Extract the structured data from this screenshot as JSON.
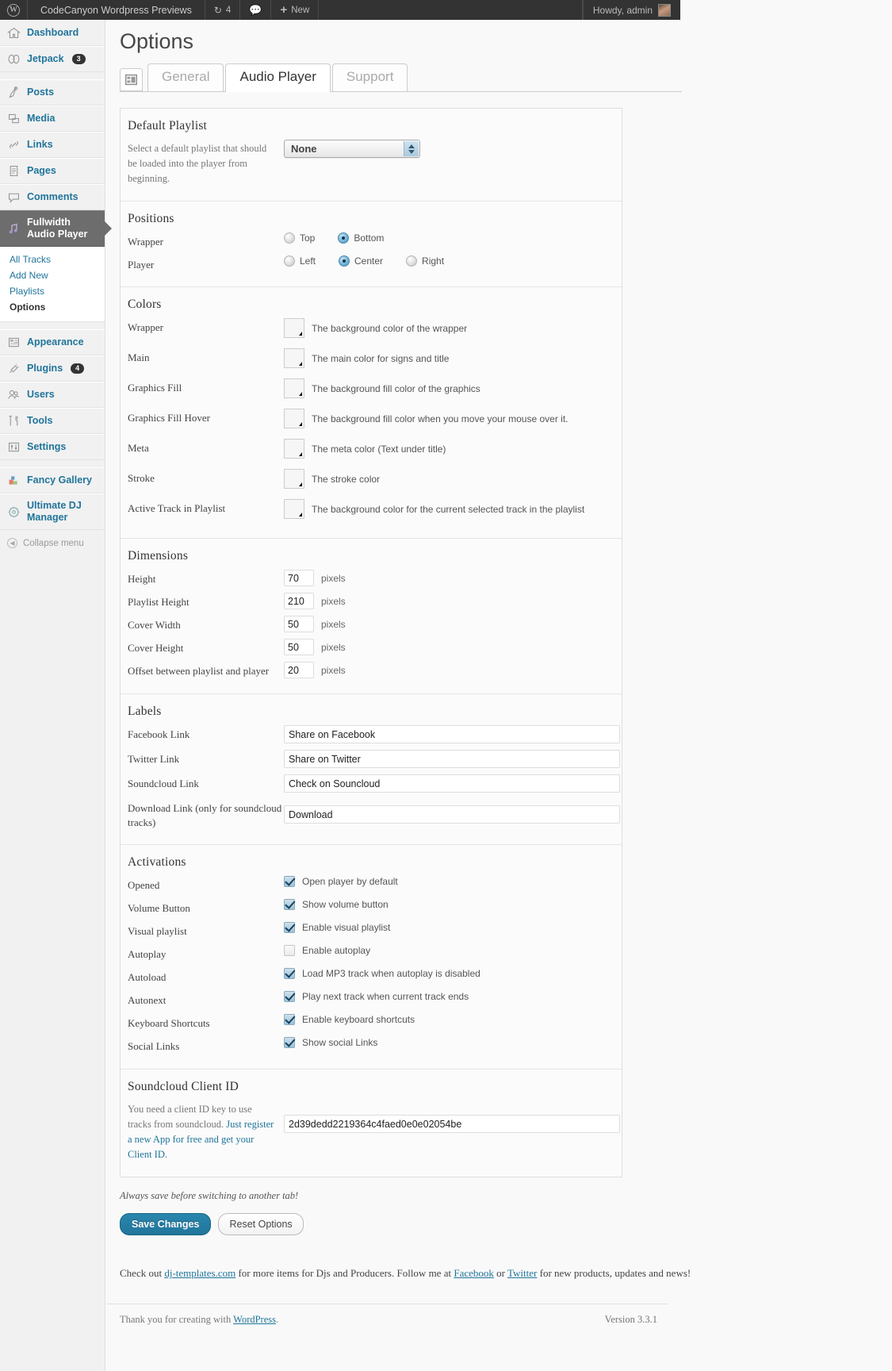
{
  "adminbar": {
    "site_name": "CodeCanyon Wordpress Previews",
    "updates_count": "4",
    "comments_icon": "comment-icon",
    "new_label": "New",
    "howdy": "Howdy, admin"
  },
  "sidebar": {
    "items": [
      {
        "label": "Dashboard",
        "icon": "dashboard-icon",
        "badge": ""
      },
      {
        "label": "Jetpack",
        "icon": "jetpack-icon",
        "badge": "3"
      },
      {
        "label": "Posts",
        "icon": "posts-icon",
        "badge": ""
      },
      {
        "label": "Media",
        "icon": "media-icon",
        "badge": ""
      },
      {
        "label": "Links",
        "icon": "links-icon",
        "badge": ""
      },
      {
        "label": "Pages",
        "icon": "pages-icon",
        "badge": ""
      },
      {
        "label": "Comments",
        "icon": "comments-icon",
        "badge": ""
      },
      {
        "label": "Fullwidth Audio Player",
        "icon": "audio-player-icon",
        "badge": ""
      }
    ],
    "submenu": [
      {
        "label": "All Tracks",
        "active": false
      },
      {
        "label": "Add New",
        "active": false
      },
      {
        "label": "Playlists",
        "active": false
      },
      {
        "label": "Options",
        "active": true
      }
    ],
    "items2": [
      {
        "label": "Appearance",
        "icon": "appearance-icon",
        "badge": ""
      },
      {
        "label": "Plugins",
        "icon": "plugins-icon",
        "badge": "4"
      },
      {
        "label": "Users",
        "icon": "users-icon",
        "badge": ""
      },
      {
        "label": "Tools",
        "icon": "tools-icon",
        "badge": ""
      },
      {
        "label": "Settings",
        "icon": "settings-icon",
        "badge": ""
      }
    ],
    "items3": [
      {
        "label": "Fancy Gallery",
        "icon": "fancy-gallery-icon",
        "badge": ""
      },
      {
        "label": "Ultimate DJ Manager",
        "icon": "ultimate-dj-icon",
        "badge": ""
      }
    ],
    "collapse_label": "Collapse menu"
  },
  "page": {
    "title": "Options"
  },
  "tabs": [
    {
      "label": "General",
      "active": false
    },
    {
      "label": "Audio Player",
      "active": true
    },
    {
      "label": "Support",
      "active": false
    }
  ],
  "default_playlist": {
    "title": "Default Playlist",
    "description": "Select a default playlist that should be loaded into the player from beginning.",
    "selected": "None"
  },
  "positions": {
    "title": "Positions",
    "rows": [
      {
        "label": "Wrapper",
        "options": [
          {
            "label": "Top",
            "selected": false
          },
          {
            "label": "Bottom",
            "selected": true
          }
        ]
      },
      {
        "label": "Player",
        "options": [
          {
            "label": "Left",
            "selected": false
          },
          {
            "label": "Center",
            "selected": true
          },
          {
            "label": "Right",
            "selected": false
          }
        ]
      }
    ]
  },
  "colors": {
    "title": "Colors",
    "rows": [
      {
        "label": "Wrapper",
        "value": "#1a1a1a",
        "desc": "The background color of the wrapper"
      },
      {
        "label": "Main",
        "value": "#ffffff",
        "desc": "The main color for signs and title"
      },
      {
        "label": "Graphics Fill",
        "value": "#0d0d0d",
        "desc": "The background fill color of the graphics"
      },
      {
        "label": "Graphics Fill Hover",
        "value": "#0d0d0d",
        "desc": "The background fill color when you move your mouse over it."
      },
      {
        "label": "Meta",
        "value": "#666666",
        "desc": "The meta color (Text under title)"
      },
      {
        "label": "Stroke",
        "value": "#2b2b2b",
        "desc": "The stroke color"
      },
      {
        "label": "Active Track in Playlist",
        "value": "#0d0d0d",
        "desc": "The background color for the current selected track in the playlist"
      }
    ]
  },
  "dimensions": {
    "title": "Dimensions",
    "unit": "pixels",
    "rows": [
      {
        "label": "Height",
        "value": "70"
      },
      {
        "label": "Playlist Height",
        "value": "210"
      },
      {
        "label": "Cover Width",
        "value": "50"
      },
      {
        "label": "Cover Height",
        "value": "50"
      },
      {
        "label": "Offset between playlist and player",
        "value": "20"
      }
    ]
  },
  "labels": {
    "title": "Labels",
    "rows": [
      {
        "label": "Facebook Link",
        "value": "Share on Facebook"
      },
      {
        "label": "Twitter Link",
        "value": "Share on Twitter"
      },
      {
        "label": "Soundcloud Link",
        "value": "Check on Souncloud"
      },
      {
        "label": "Download Link (only for soundcloud tracks)",
        "value": "Download"
      }
    ]
  },
  "activations": {
    "title": "Activations",
    "rows": [
      {
        "label": "Opened",
        "desc": "Open player by default",
        "checked": true
      },
      {
        "label": "Volume Button",
        "desc": "Show volume button",
        "checked": true
      },
      {
        "label": "Visual playlist",
        "desc": "Enable visual playlist",
        "checked": true
      },
      {
        "label": "Autoplay",
        "desc": "Enable autoplay",
        "checked": false
      },
      {
        "label": "Autoload",
        "desc": "Load MP3 track when autoplay is disabled",
        "checked": true
      },
      {
        "label": "Autonext",
        "desc": "Play next track when current track ends",
        "checked": true
      },
      {
        "label": "Keyboard Shortcuts",
        "desc": "Enable keyboard shortcuts",
        "checked": true
      },
      {
        "label": "Social Links",
        "desc": "Show social Links",
        "checked": true
      }
    ]
  },
  "soundcloud": {
    "title": "Soundcloud Client ID",
    "description": "You need a client ID key to use tracks from soundcloud.",
    "link_text": "Just register a new App for free and get your Client ID.",
    "value": "2d39dedd2219364c4faed0e0e02054be"
  },
  "footer_actions": {
    "note": "Always save before switching to another tab!",
    "save_label": "Save Changes",
    "reset_label": "Reset Options"
  },
  "promo": {
    "prefix": "Check out ",
    "link1": "dj-templates.com",
    "middle": " for more items for Djs and Producers. Follow me at ",
    "link2": "Facebook",
    "or": " or ",
    "link3": "Twitter",
    "suffix": " for new products, updates and news!"
  },
  "admin_footer": {
    "thanks_prefix": "Thank you for creating with ",
    "wordpress": "WordPress",
    "thanks_suffix": ".",
    "version": "Version 3.3.1"
  },
  "theme": {
    "accent": "#21759b",
    "adminbar_bg": "#333333",
    "current_menu_bg": "#6d6d6d"
  }
}
